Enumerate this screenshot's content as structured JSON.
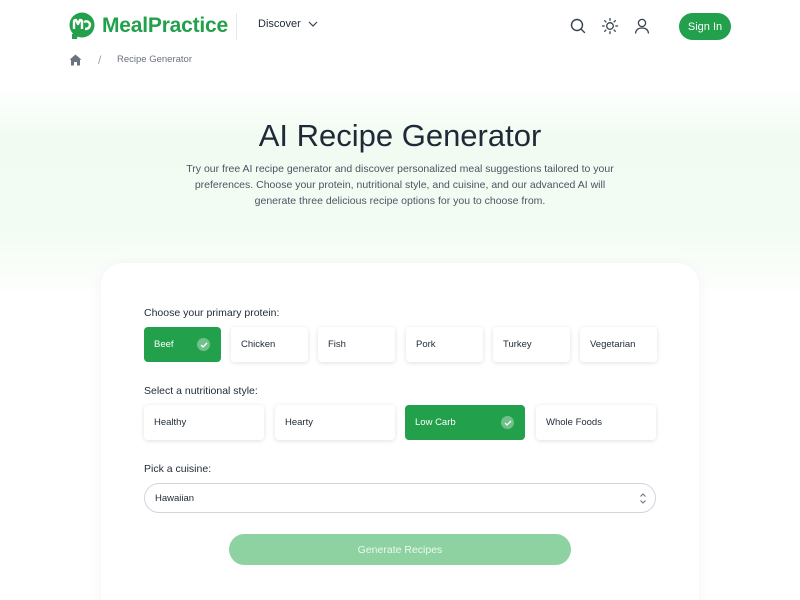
{
  "header": {
    "brand": "MealPractice",
    "nav_discover": "Discover",
    "signin_label": "Sign In",
    "icons": [
      "search-icon",
      "sun-icon",
      "user-icon",
      "chevron-down-icon"
    ]
  },
  "breadcrumb": {
    "home_icon": "home-icon",
    "current": "Recipe Generator"
  },
  "hero": {
    "title": "AI Recipe Generator",
    "description": "Try our free AI recipe generator and discover personalized meal suggestions tailored to your preferences. Choose your protein, nutritional style, and cuisine, and our advanced AI will generate three delicious recipe options for you to choose from."
  },
  "form": {
    "protein_label": "Choose your primary protein:",
    "proteins": [
      {
        "label": "Beef",
        "selected": true
      },
      {
        "label": "Chicken",
        "selected": false
      },
      {
        "label": "Fish",
        "selected": false
      },
      {
        "label": "Pork",
        "selected": false
      },
      {
        "label": "Turkey",
        "selected": false
      },
      {
        "label": "Vegetarian",
        "selected": false
      }
    ],
    "style_label": "Select a nutritional style:",
    "styles": [
      {
        "label": "Healthy",
        "selected": false
      },
      {
        "label": "Hearty",
        "selected": false
      },
      {
        "label": "Low Carb",
        "selected": true
      },
      {
        "label": "Whole Foods",
        "selected": false
      }
    ],
    "cuisine_label": "Pick a cuisine:",
    "cuisine_value": "Hawaiian",
    "generate_label": "Generate Recipes"
  },
  "colors": {
    "brand": "#22a04b",
    "generate_disabled": "#8dd2a0"
  }
}
